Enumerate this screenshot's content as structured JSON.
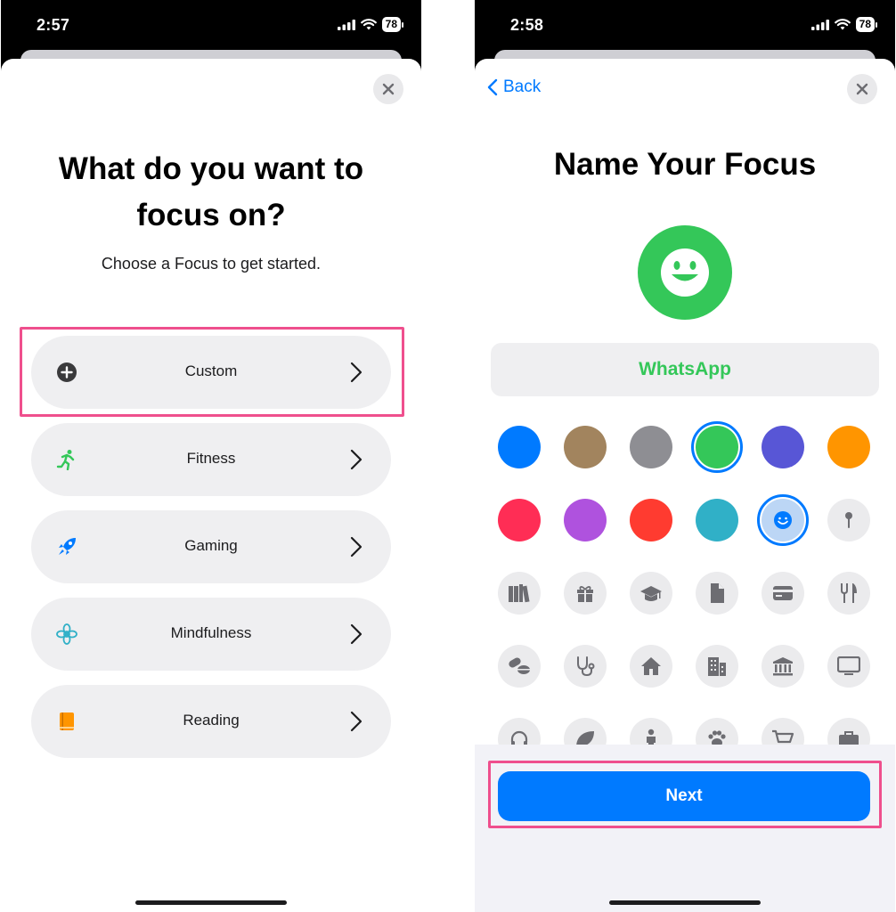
{
  "left_screen": {
    "status": {
      "time": "2:57",
      "battery": "78"
    },
    "title": "What do you want to focus on?",
    "subtitle": "Choose a Focus to get started.",
    "options": [
      {
        "label": "Custom",
        "icon": "plus-circle-icon",
        "color": "#3a3a3c"
      },
      {
        "label": "Fitness",
        "icon": "running-figure-icon",
        "color": "#34c759"
      },
      {
        "label": "Gaming",
        "icon": "rocket-icon",
        "color": "#007aff"
      },
      {
        "label": "Mindfulness",
        "icon": "flower-icon",
        "color": "#30b0c7"
      },
      {
        "label": "Reading",
        "icon": "book-icon",
        "color": "#ff9500"
      }
    ],
    "highlighted_option": "Custom"
  },
  "right_screen": {
    "status": {
      "time": "2:58",
      "battery": "78"
    },
    "back_label": "Back",
    "title": "Name Your Focus",
    "focus_name": "WhatsApp",
    "selected_color": "#34c759",
    "selected_glyph": "smiley-icon",
    "colors": [
      "#007aff",
      "#a2845e",
      "#8e8e93",
      "#34c759",
      "#5856d6",
      "#ff9500",
      "#ff2d55",
      "#af52de",
      "#ff3b30",
      "#30b0c7"
    ],
    "symbols": [
      "smiley-icon",
      "pin-icon",
      "books-icon",
      "gift-icon",
      "graduation-cap-icon",
      "document-icon",
      "credit-card-icon",
      "fork-knife-icon",
      "pills-icon",
      "stethoscope-icon",
      "house-icon",
      "building-icon",
      "bank-icon",
      "monitor-icon",
      "headphones-icon",
      "leaf-icon",
      "person-icon",
      "paw-icon",
      "cart-icon",
      "briefcase-icon"
    ],
    "next_label": "Next"
  }
}
